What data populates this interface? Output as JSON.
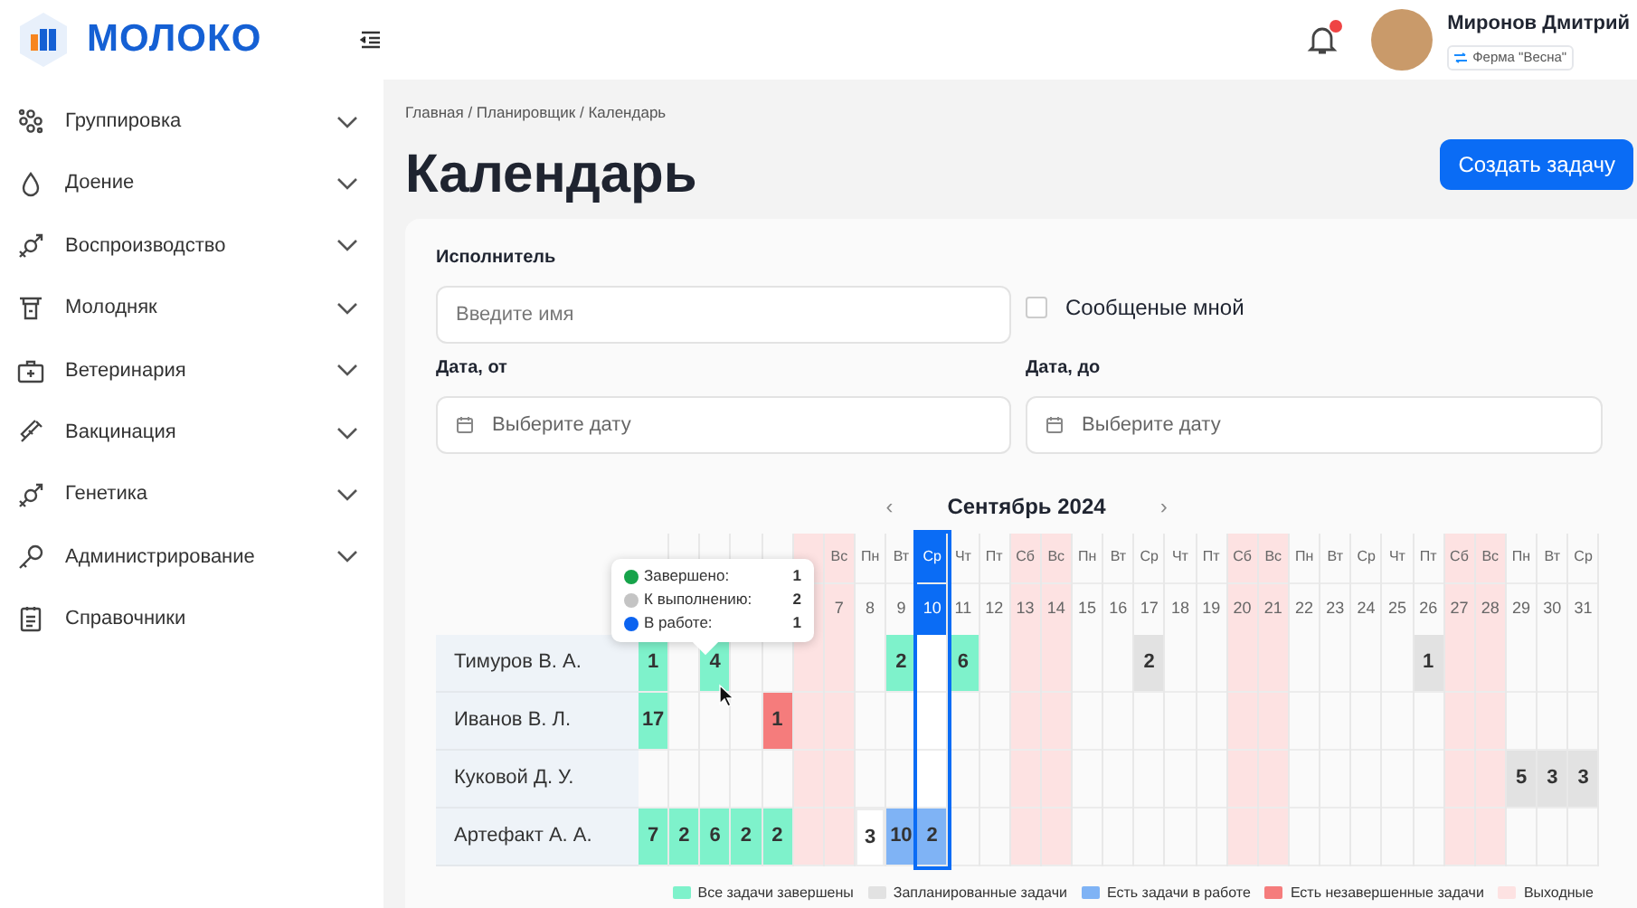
{
  "brand": {
    "name": "МОЛОКО"
  },
  "user": {
    "name": "Миронов Дмитрий",
    "farm": "Ферма \"Весна\"",
    "has_notifications": true
  },
  "sidebar": {
    "items": [
      {
        "label": "Группировка",
        "expandable": true
      },
      {
        "label": "Доение",
        "expandable": true
      },
      {
        "label": "Воспроизводство",
        "expandable": true
      },
      {
        "label": "Молодняк",
        "expandable": true
      },
      {
        "label": "Ветеринария",
        "expandable": true
      },
      {
        "label": "Вакцинация",
        "expandable": true
      },
      {
        "label": "Генетика",
        "expandable": true
      },
      {
        "label": "Администрирование",
        "expandable": true
      },
      {
        "label": "Справочники",
        "expandable": false
      }
    ]
  },
  "breadcrumb": "Главная / Планировщик / Календарь",
  "title": "Календарь",
  "create_button": "Создать задачу",
  "filters": {
    "assignee_label": "Исполнитель",
    "assignee_placeholder": "Введите имя",
    "mine_label": "Сообщеные мной",
    "mine_checked": false,
    "date_from_label": "Дата, от",
    "date_from_placeholder": "Выберите дату",
    "date_to_label": "Дата, до",
    "date_to_placeholder": "Выберите дату"
  },
  "calendar": {
    "month": "Сентябрь 2024",
    "prev": "‹",
    "next": "›",
    "days": [
      {
        "weekend": false,
        "selected": false
      },
      {
        "weekend": false,
        "selected": false
      },
      {
        "weekend": false,
        "selected": false
      },
      {
        "weekend": false,
        "selected": false
      },
      {
        "weekend": false,
        "selected": false
      },
      {
        "weekend": true,
        "selected": false
      },
      {
        "weekday": "Вс",
        "day": "7",
        "weekend": true,
        "selected": false
      },
      {
        "weekday": "Пн",
        "day": "8",
        "weekend": false,
        "selected": false
      },
      {
        "weekday": "Вт",
        "day": "9",
        "weekend": false,
        "selected": false
      },
      {
        "weekday": "Ср",
        "day": "10",
        "weekend": false,
        "selected": true
      },
      {
        "weekday": "Чт",
        "day": "11",
        "weekend": false,
        "selected": false
      },
      {
        "weekday": "Пт",
        "day": "12",
        "weekend": false,
        "selected": false
      },
      {
        "weekday": "Сб",
        "day": "13",
        "weekend": true,
        "selected": false
      },
      {
        "weekday": "Вс",
        "day": "14",
        "weekend": true,
        "selected": false
      },
      {
        "weekday": "Пн",
        "day": "15",
        "weekend": false,
        "selected": false
      },
      {
        "weekday": "Вт",
        "day": "16",
        "weekend": false,
        "selected": false
      },
      {
        "weekday": "Ср",
        "day": "17",
        "weekend": false,
        "selected": false
      },
      {
        "weekday": "Чт",
        "day": "18",
        "weekend": false,
        "selected": false
      },
      {
        "weekday": "Пт",
        "day": "19",
        "weekend": false,
        "selected": false
      },
      {
        "weekday": "Сб",
        "day": "20",
        "weekend": true,
        "selected": false
      },
      {
        "weekday": "Вс",
        "day": "21",
        "weekend": true,
        "selected": false
      },
      {
        "weekday": "Пн",
        "day": "22",
        "weekend": false,
        "selected": false
      },
      {
        "weekday": "Вт",
        "day": "23",
        "weekend": false,
        "selected": false
      },
      {
        "weekday": "Ср",
        "day": "24",
        "weekend": false,
        "selected": false
      },
      {
        "weekday": "Чт",
        "day": "25",
        "weekend": false,
        "selected": false
      },
      {
        "weekday": "Пт",
        "day": "26",
        "weekend": false,
        "selected": false
      },
      {
        "weekday": "Сб",
        "day": "27",
        "weekend": true,
        "selected": false
      },
      {
        "weekday": "Вс",
        "day": "28",
        "weekend": true,
        "selected": false
      },
      {
        "weekday": "Пн",
        "day": "29",
        "weekend": false,
        "selected": false
      },
      {
        "weekday": "Вт",
        "day": "30",
        "weekend": false,
        "selected": false
      },
      {
        "weekday": "Ср",
        "day": "31",
        "weekend": false,
        "selected": false
      }
    ],
    "rows": [
      {
        "name": "Тимуров В. А.",
        "cells": [
          {
            "value": "1",
            "kind": "done"
          },
          null,
          {
            "value": "4",
            "kind": "done"
          },
          null,
          null,
          null,
          null,
          null,
          {
            "value": "2",
            "kind": "done"
          },
          null,
          {
            "value": "6",
            "kind": "done"
          },
          null,
          null,
          null,
          null,
          null,
          {
            "value": "2",
            "kind": "planned"
          },
          null,
          null,
          null,
          null,
          null,
          null,
          null,
          null,
          {
            "value": "1",
            "kind": "planned"
          },
          null,
          null,
          null,
          null,
          null
        ]
      },
      {
        "name": "Иванов В. Л.",
        "cells": [
          {
            "value": "17",
            "kind": "done"
          },
          null,
          null,
          null,
          {
            "value": "1",
            "kind": "overdue"
          },
          null,
          null,
          null,
          null,
          null,
          null,
          null,
          null,
          null,
          null,
          null,
          null,
          null,
          null,
          null,
          null,
          null,
          null,
          null,
          null,
          null,
          null,
          null,
          null,
          null,
          null
        ]
      },
      {
        "name": "Куковой Д. У.",
        "cells": [
          null,
          null,
          null,
          null,
          null,
          null,
          null,
          null,
          null,
          null,
          null,
          null,
          null,
          null,
          null,
          null,
          null,
          null,
          null,
          null,
          null,
          null,
          null,
          null,
          null,
          null,
          null,
          null,
          {
            "value": "5",
            "kind": "planned"
          },
          {
            "value": "3",
            "kind": "planned"
          },
          {
            "value": "3",
            "kind": "planned"
          }
        ]
      },
      {
        "name": "Артефакт А. А.",
        "cells": [
          {
            "value": "7",
            "kind": "done"
          },
          {
            "value": "2",
            "kind": "done"
          },
          {
            "value": "6",
            "kind": "done"
          },
          {
            "value": "2",
            "kind": "done"
          },
          {
            "value": "2",
            "kind": "done"
          },
          null,
          null,
          {
            "value": "3",
            "kind": "outlined"
          },
          {
            "value": "10",
            "kind": "in_work"
          },
          {
            "value": "2",
            "kind": "in_work"
          },
          null,
          null,
          null,
          null,
          null,
          null,
          null,
          null,
          null,
          null,
          null,
          null,
          null,
          null,
          null,
          null,
          null,
          null,
          null,
          null,
          null
        ]
      }
    ],
    "tooltip": [
      {
        "label": "Завершено:",
        "value": "1",
        "color": "#16a34a"
      },
      {
        "label": "К выполнению:",
        "value": "2",
        "color": "#c4c4c4"
      },
      {
        "label": "В работе:",
        "value": "1",
        "color": "#0b63f0"
      }
    ]
  },
  "legend": [
    {
      "label": "Все задачи завершены",
      "color": "#7ef2cb"
    },
    {
      "label": "Запланированные задачи",
      "color": "#e2e2e2"
    },
    {
      "label": "Есть задачи в работе",
      "color": "#7fb3f5"
    },
    {
      "label": "Есть незавершенные задачи",
      "color": "#f57c7c"
    },
    {
      "label": "Выходные",
      "color": "#fde2e2"
    }
  ]
}
